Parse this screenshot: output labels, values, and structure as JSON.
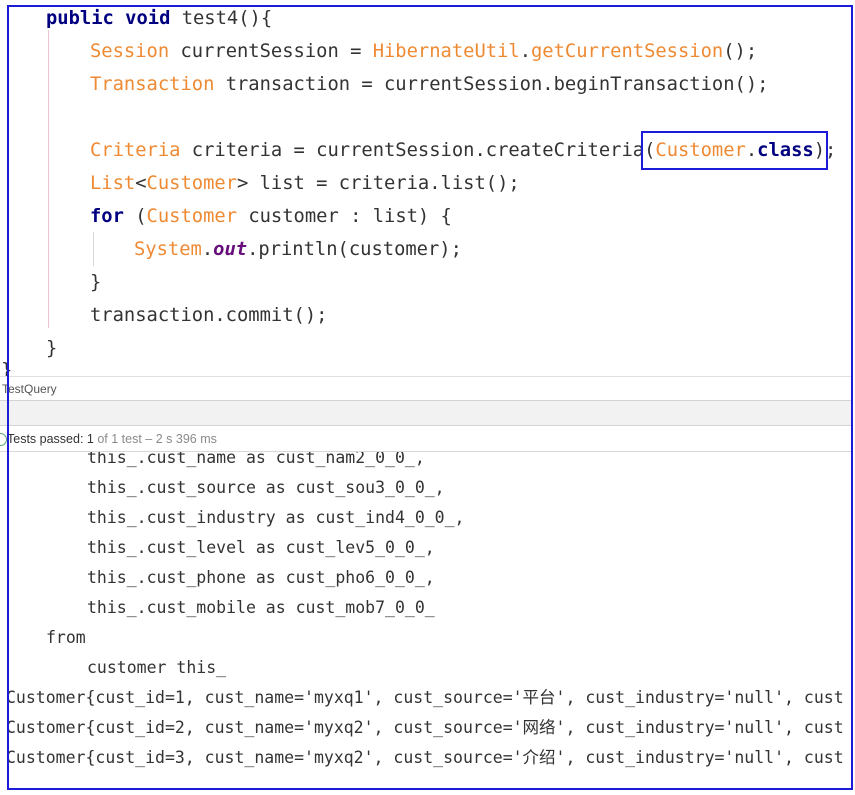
{
  "colors": {
    "keyword": "#000080",
    "type": "#ee8a33",
    "static_field": "#660e7a",
    "plain": "#333333",
    "annotation_box": "#1c1cd8",
    "test_passed": "#59a869"
  },
  "editor": {
    "lines": [
      {
        "tokens": [
          "public",
          " ",
          "void",
          " test4(){"
        ]
      },
      {
        "tokens": [
          "Session",
          " currentSession = ",
          "HibernateUtil",
          ".",
          "getCurrentSession",
          "();"
        ]
      },
      {
        "tokens": [
          "Transaction",
          " transaction = currentSession.beginTransaction();"
        ]
      },
      {
        "tokens": []
      },
      {
        "tokens": [
          "Criteria",
          " criteria = currentSession.createCriteria",
          "(",
          "Customer",
          ".",
          "class",
          ")",
          ";"
        ]
      },
      {
        "tokens": [
          "List",
          "<",
          "Customer",
          "> list = criteria.list();"
        ]
      },
      {
        "tokens": [
          "for",
          " (",
          "Customer",
          " customer : list) {"
        ]
      },
      {
        "tokens": [
          "System",
          ".",
          "out",
          ".println(customer);"
        ]
      },
      {
        "tokens": [
          "}"
        ]
      },
      {
        "tokens": [
          "transaction.commit();"
        ]
      },
      {
        "tokens": [
          "}"
        ]
      }
    ],
    "cut_off_brace": "}"
  },
  "test_panel": {
    "tab_title": "TestQuery",
    "status_label": "Tests passed:",
    "passed_count": "1",
    "status_detail": "of 1 test – 2 s 396 ms"
  },
  "console": {
    "lines": [
      "this_.cust_name as cust_nam2_0_0_,",
      "this_.cust_source as cust_sou3_0_0_,",
      "this_.cust_industry as cust_ind4_0_0_,",
      "this_.cust_level as cust_lev5_0_0_,",
      "this_.cust_phone as cust_pho6_0_0_,",
      "this_.cust_mobile as cust_mob7_0_0_",
      "from",
      "customer this_",
      "Customer{cust_id=1, cust_name='myxq1', cust_source='平台', cust_industry='null', cust",
      "Customer{cust_id=2, cust_name='myxq2', cust_source='网络', cust_industry='null', cust",
      "Customer{cust_id=3, cust_name='myxq2', cust_source='介绍', cust_industry='null', cust"
    ]
  }
}
